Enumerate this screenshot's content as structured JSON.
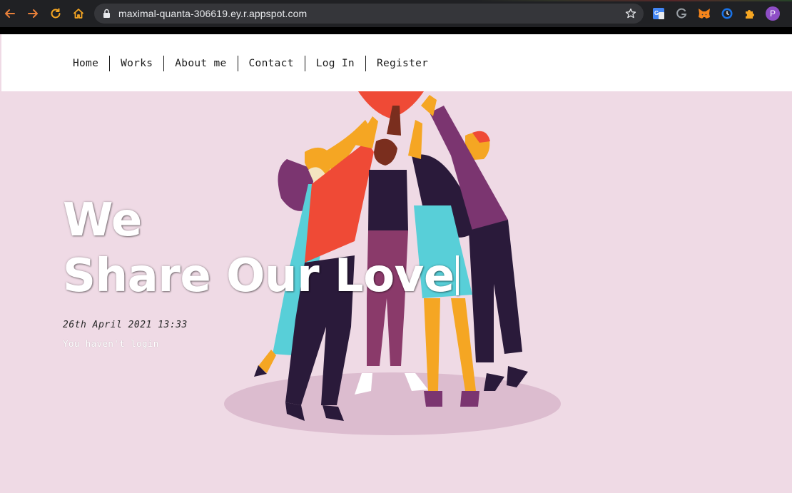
{
  "browser": {
    "url": "maximal-quanta-306619.ey.r.appspot.com",
    "profile_initial": "P",
    "icons": [
      "back-icon",
      "forward-icon",
      "reload-icon",
      "home-icon",
      "lock-icon",
      "star-icon",
      "translate-icon",
      "grammarly-icon",
      "metamask-icon",
      "clock-icon",
      "puzzle-icon"
    ],
    "colors": {
      "toolbar": "#202124",
      "omnibox": "#35363a",
      "accent": "#f5a623",
      "avatar": "#8e4ec6"
    }
  },
  "nav": {
    "items": [
      {
        "label": "Home"
      },
      {
        "label": "Works"
      },
      {
        "label": "About me"
      },
      {
        "label": "Contact"
      },
      {
        "label": "Log In"
      },
      {
        "label": "Register"
      }
    ]
  },
  "hero": {
    "title_line1": "We",
    "title_line2": "Share Our Love",
    "date": "26th April 2021 13:33",
    "status": "You haven't login",
    "colors": {
      "background": "#efdae5",
      "shadow": "#dcbccf",
      "heart": "#ef4a36"
    }
  }
}
